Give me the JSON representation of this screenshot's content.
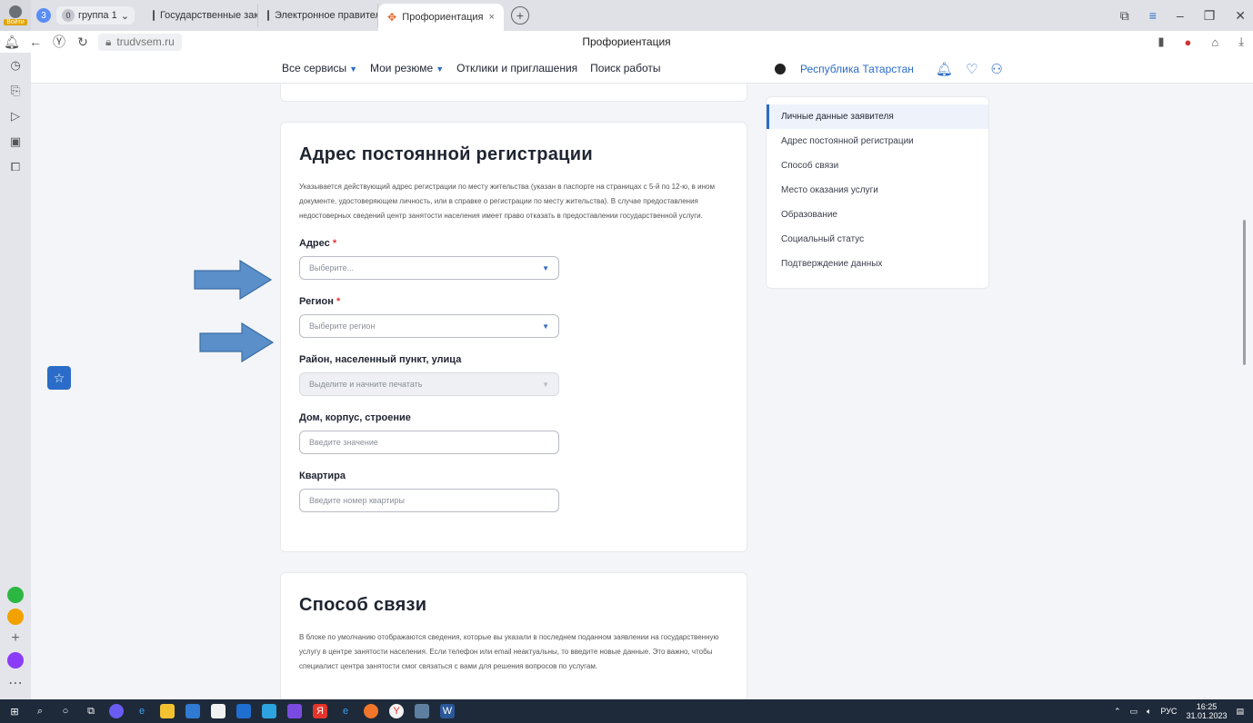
{
  "browser": {
    "profile_label": "Войти",
    "tab_count": "3",
    "tab_group_count": "0",
    "tab_group_label": "группа 1",
    "tabs": [
      {
        "label": "Государственные закупки"
      },
      {
        "label": "Электронное правительс"
      },
      {
        "label": "Профориентация"
      }
    ],
    "url": "trudvsem.ru",
    "page_title": "Профориентация"
  },
  "site": {
    "nav": [
      {
        "label": "Все сервисы"
      },
      {
        "label": "Мои резюме"
      },
      {
        "label": "Отклики и приглашения"
      },
      {
        "label": "Поиск работы"
      }
    ],
    "region": "Республика Татарстан"
  },
  "address_section": {
    "title": "Адрес постоянной регистрации",
    "description": "Указывается действующий адрес регистрации по месту жительства (указан в паспорте на страницах с 5-й по 12-ю, в ином документе, удостоверяющем личность, или в справке о регистрации по месту жительства). В случае предоставления недостоверных сведений центр занятости населения имеет право отказать в предоставлении государственной услуги.",
    "fields": [
      {
        "label": "Адрес",
        "required": "*",
        "placeholder": "Выберите..."
      },
      {
        "label": "Регион",
        "required": "*",
        "placeholder": "Выберите регион"
      },
      {
        "label": "Район, населенный пункт, улица",
        "placeholder": "Выделите и начните печатать"
      },
      {
        "label": "Дом, корпус, строение",
        "placeholder": "Введите значение"
      },
      {
        "label": "Квартира",
        "placeholder": "Введите номер квартиры"
      }
    ]
  },
  "contact_section": {
    "title": "Способ связи",
    "description": "В блоке по умолчанию отображаются сведения, которые вы указали в последнем поданном заявлении на государственную услугу в центре занятости населения. Если телефон или email неактуальны, то введите новые данные. Это важно, чтобы специалист центра занятости смог связаться с вами для решения вопросов по услугам."
  },
  "side_menu": {
    "items": [
      {
        "label": "Личные данные заявителя"
      },
      {
        "label": "Адрес постоянной регистрации"
      },
      {
        "label": "Способ связи"
      },
      {
        "label": "Место оказания услуги"
      },
      {
        "label": "Образование"
      },
      {
        "label": "Социальный статус"
      },
      {
        "label": "Подтверждение данных"
      }
    ]
  },
  "taskbar": {
    "lang": "РУС",
    "time": "16:25",
    "date": "31.01.2023"
  },
  "colors": {
    "accent": "#2a6cc7",
    "arrow": "#5b8fc9",
    "required": "#e5342a"
  }
}
